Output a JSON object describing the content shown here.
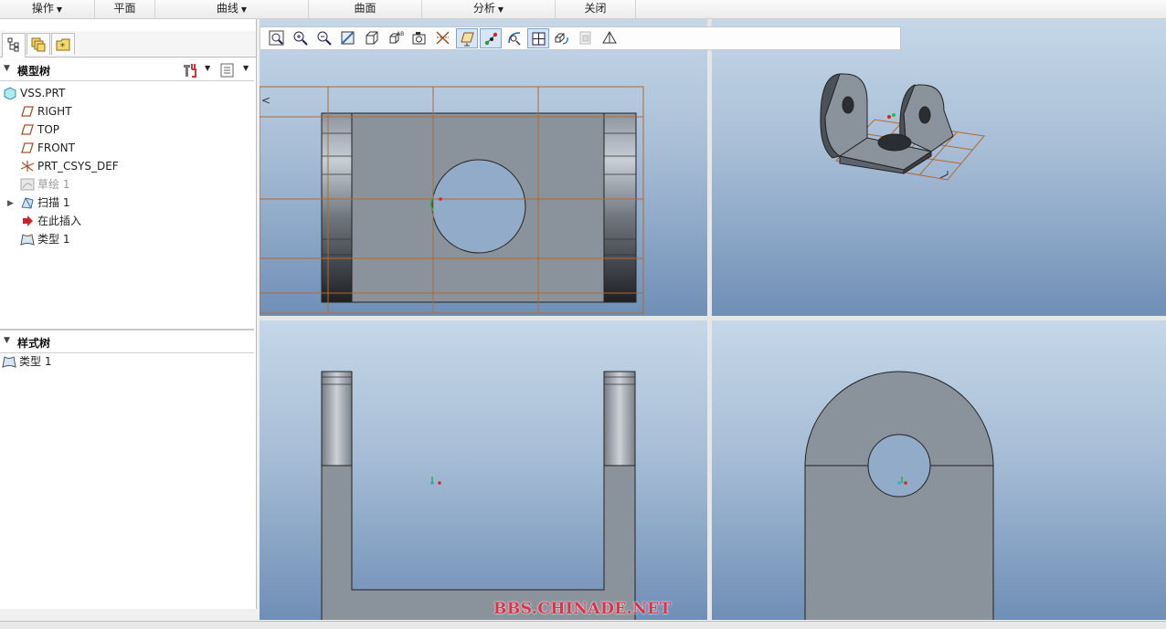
{
  "menu": {
    "items": [
      {
        "label": "操作",
        "dropdown": true
      },
      {
        "label": "平面",
        "dropdown": false
      },
      {
        "label": "曲线",
        "dropdown": true
      },
      {
        "label": "曲面",
        "dropdown": false
      },
      {
        "label": "分析",
        "dropdown": true
      },
      {
        "label": "关闭",
        "dropdown": false
      }
    ]
  },
  "panel_tabs": [
    "model-tree-tab-icon",
    "layers-tab-icon",
    "favorites-tab-icon"
  ],
  "model_tree": {
    "title": "模型树",
    "items": [
      {
        "label": "VSS.PRT",
        "icon": "part-icon"
      },
      {
        "label": "RIGHT",
        "icon": "datum-plane-icon"
      },
      {
        "label": "TOP",
        "icon": "datum-plane-icon"
      },
      {
        "label": "FRONT",
        "icon": "datum-plane-icon"
      },
      {
        "label": "PRT_CSYS_DEF",
        "icon": "csys-icon"
      },
      {
        "label": "草绘 1",
        "icon": "sketch-icon",
        "dimmed": true
      },
      {
        "label": "扫描 1",
        "icon": "sweep-icon"
      },
      {
        "label": "在此插入",
        "icon": "insert-here-icon"
      },
      {
        "label": "类型 1",
        "icon": "style-icon"
      }
    ]
  },
  "style_tree": {
    "title": "样式树",
    "items": [
      {
        "label": "类型 1",
        "icon": "style-icon"
      }
    ]
  },
  "view_toolbar": {
    "buttons": [
      {
        "name": "zoom-fit-icon",
        "active": false
      },
      {
        "name": "zoom-in-icon",
        "active": false
      },
      {
        "name": "zoom-out-icon",
        "active": false
      },
      {
        "name": "repaint-icon",
        "active": false
      },
      {
        "name": "display-style-icon",
        "active": false
      },
      {
        "name": "saved-views-icon",
        "active": false
      },
      {
        "name": "view-manager-icon",
        "active": false
      },
      {
        "name": "datum-axis-display-icon",
        "active": false
      },
      {
        "name": "datum-plane-display-icon",
        "active": true
      },
      {
        "name": "datum-point-display-icon",
        "active": true
      },
      {
        "name": "csys-display-icon",
        "active": false
      },
      {
        "name": "four-view-icon",
        "active": true
      },
      {
        "name": "view-orient-icon",
        "active": false
      },
      {
        "name": "section-view-icon",
        "active": false
      },
      {
        "name": "perspective-icon",
        "active": false
      }
    ]
  },
  "watermark": "BBS.CHINADE.NET",
  "colors": {
    "model_fill": "#8a929c",
    "model_edge": "#2a2a2a",
    "datum_plane": "#b06a32",
    "viewport_top": "#c5d7e8",
    "viewport_bottom": "#6f8fb6",
    "toolbar_active": "#d6e6f7"
  }
}
